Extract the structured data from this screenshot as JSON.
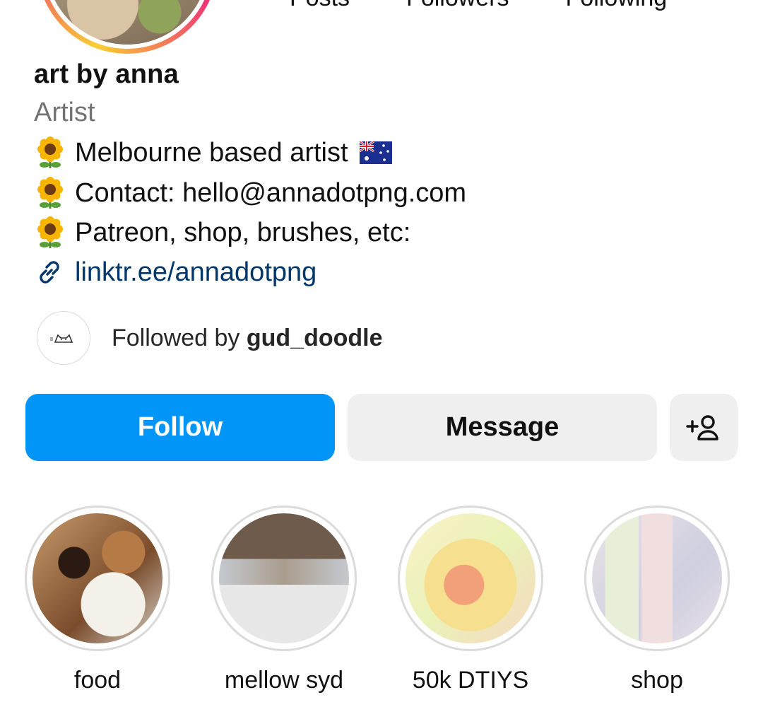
{
  "header": {
    "stats_labels": [
      "Posts",
      "Followers",
      "Following"
    ]
  },
  "profile": {
    "display_name": "art by anna",
    "category": "Artist",
    "bio": [
      {
        "icon": "sunflower-icon",
        "text": "Melbourne based artist",
        "trailing_icon": "australia-flag-icon"
      },
      {
        "icon": "sunflower-icon",
        "text": "Contact: hello@annadotpng.com"
      },
      {
        "icon": "sunflower-icon",
        "text": "Patreon, shop, brushes, etc:"
      }
    ],
    "link": {
      "icon": "link-icon",
      "text": "linktr.ee/annadotpng",
      "color": "#00376b"
    }
  },
  "followed_by": {
    "prefix": "Followed by",
    "username": "gud_doodle"
  },
  "actions": {
    "follow_label": "Follow",
    "message_label": "Message",
    "suggest_icon": "add-person-icon",
    "follow_color": "#0095f6",
    "secondary_color": "#efefef"
  },
  "highlights": [
    {
      "label": "food"
    },
    {
      "label": "mellow syd"
    },
    {
      "label": "50k DTIYS"
    },
    {
      "label": "shop"
    }
  ]
}
